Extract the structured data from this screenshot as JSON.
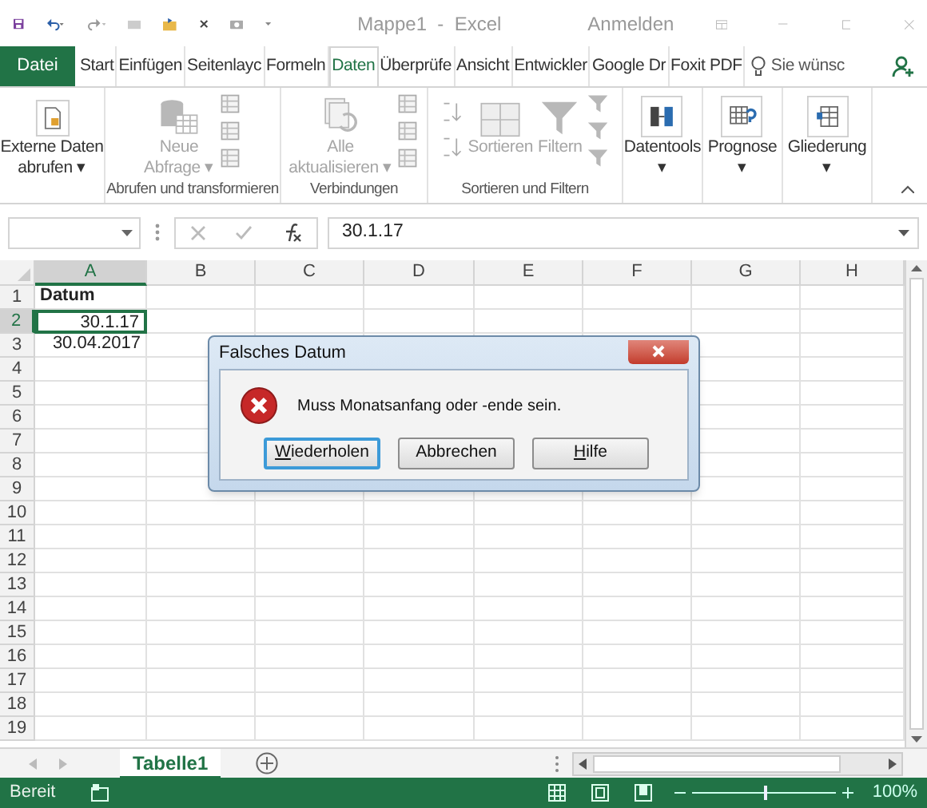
{
  "window": {
    "title": "Mappe1  -  Excel",
    "sign_in": "Anmelden"
  },
  "tabs": [
    {
      "label": "Datei",
      "kind": "file",
      "selected": false
    },
    {
      "label": "Start",
      "kind": "tab",
      "selected": false
    },
    {
      "label": "Einfügen",
      "kind": "tab",
      "selected": false
    },
    {
      "label": "Seitenlayc",
      "kind": "tab",
      "selected": false
    },
    {
      "label": "Formeln",
      "kind": "tab",
      "selected": false
    },
    {
      "label": "Daten",
      "kind": "tab",
      "selected": true
    },
    {
      "label": "Überprüfe",
      "kind": "tab",
      "selected": false
    },
    {
      "label": "Ansicht",
      "kind": "tab",
      "selected": false
    },
    {
      "label": "Entwickler",
      "kind": "tab",
      "selected": false
    },
    {
      "label": "Google Dr",
      "kind": "tab",
      "selected": false
    },
    {
      "label": "Foxit PDF",
      "kind": "tab",
      "selected": false
    }
  ],
  "tell_me": {
    "placeholder": "Sie wünsc"
  },
  "ribbon": {
    "groups": [
      {
        "items": [
          {
            "kind": "large",
            "lines": [
              "Externe Daten",
              "abrufen ▾"
            ],
            "disabled": false
          }
        ]
      },
      {
        "label": "Abrufen und transformieren",
        "items": [
          {
            "kind": "large",
            "lines": [
              "Neue",
              "Abfrage ▾"
            ],
            "disabled": true
          },
          {
            "kind": "smallstack"
          }
        ]
      },
      {
        "label": "Verbindungen",
        "items": [
          {
            "kind": "large",
            "lines": [
              "Alle",
              "aktualisieren ▾"
            ],
            "disabled": true
          },
          {
            "kind": "smallstack"
          }
        ]
      },
      {
        "label": "Sortieren und Filtern",
        "items": [
          {
            "kind": "sortstack"
          },
          {
            "kind": "large",
            "lines": [
              "Sortieren"
            ],
            "disabled": true
          },
          {
            "kind": "large",
            "lines": [
              "Filtern"
            ],
            "disabled": true
          },
          {
            "kind": "filterstack"
          }
        ]
      },
      {
        "items": [
          {
            "kind": "large",
            "lines": [
              "Datentools",
              "▾"
            ],
            "disabled": false
          }
        ]
      },
      {
        "items": [
          {
            "kind": "large",
            "lines": [
              "Prognose",
              "▾"
            ],
            "disabled": false
          }
        ]
      },
      {
        "items": [
          {
            "kind": "large",
            "lines": [
              "Gliederung",
              "▾"
            ],
            "disabled": false
          }
        ]
      }
    ]
  },
  "formula_bar": {
    "value": "30.1.17"
  },
  "sheet": {
    "columns": [
      {
        "label": "A",
        "selected": true
      },
      {
        "label": "B",
        "selected": false
      },
      {
        "label": "C",
        "selected": false
      },
      {
        "label": "D",
        "selected": false
      },
      {
        "label": "E",
        "selected": false
      },
      {
        "label": "F",
        "selected": false
      },
      {
        "label": "G",
        "selected": false
      },
      {
        "label": "H",
        "selected": false
      }
    ],
    "rows": [
      {
        "label": "1",
        "selected": false,
        "cells": [
          {
            "value": "Datum",
            "kind": "bold",
            "selected": false
          }
        ]
      },
      {
        "label": "2",
        "selected": true,
        "cells": [
          {
            "value": "30.1.17",
            "kind": "number",
            "selected": true
          }
        ]
      },
      {
        "label": "3",
        "selected": false,
        "cells": [
          {
            "value": "30.04.2017",
            "kind": "number",
            "selected": false
          }
        ]
      },
      {
        "label": "4",
        "selected": false,
        "cells": []
      },
      {
        "label": "5",
        "selected": false,
        "cells": []
      },
      {
        "label": "6",
        "selected": false,
        "cells": []
      },
      {
        "label": "7",
        "selected": false,
        "cells": []
      },
      {
        "label": "8",
        "selected": false,
        "cells": []
      },
      {
        "label": "9",
        "selected": false,
        "cells": []
      },
      {
        "label": "10",
        "selected": false,
        "cells": []
      },
      {
        "label": "11",
        "selected": false,
        "cells": []
      },
      {
        "label": "12",
        "selected": false,
        "cells": []
      },
      {
        "label": "13",
        "selected": false,
        "cells": []
      },
      {
        "label": "14",
        "selected": false,
        "cells": []
      },
      {
        "label": "15",
        "selected": false,
        "cells": []
      },
      {
        "label": "16",
        "selected": false,
        "cells": []
      },
      {
        "label": "17",
        "selected": false,
        "cells": []
      },
      {
        "label": "18",
        "selected": false,
        "cells": []
      },
      {
        "label": "19",
        "selected": false,
        "cells": []
      }
    ]
  },
  "sheet_tabs": [
    {
      "label": "Tabelle1",
      "selected": true
    }
  ],
  "dialog": {
    "title": "Falsches Datum",
    "message": "Muss Monatsanfang oder -ende sein.",
    "buttons": [
      {
        "label": "Wiederholen",
        "underline_first": true,
        "focused": true
      },
      {
        "label": "Abbrechen",
        "underline_first": false,
        "focused": false
      },
      {
        "label": "Hilfe",
        "underline_first": true,
        "focused": false
      }
    ]
  },
  "status_bar": {
    "status": "Bereit",
    "zoom": "100%",
    "zoom_level": {
      "level": 0.5
    }
  }
}
